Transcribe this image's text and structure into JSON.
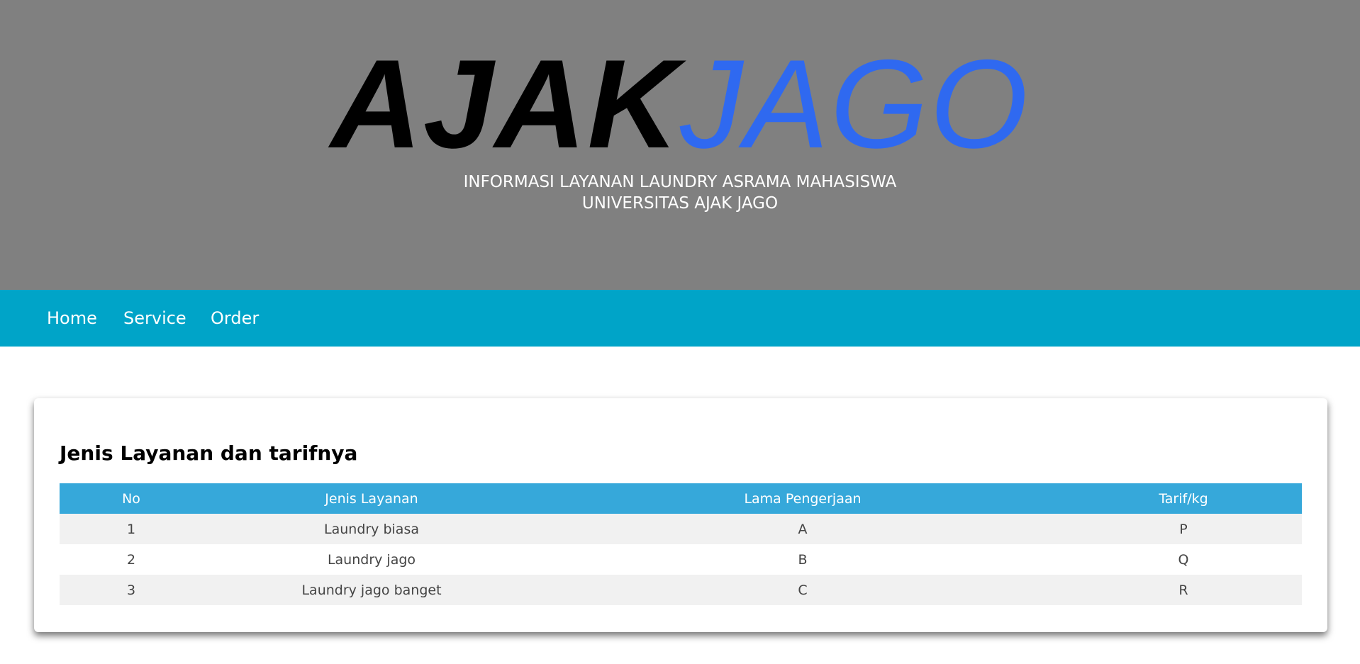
{
  "header": {
    "logo_bold": "AJAK",
    "logo_light": "JAGO",
    "subtitle_line1": "INFORMASI LAYANAN LAUNDRY ASRAMA MAHASISWA",
    "subtitle_line2": "UNIVERSITAS AJAK JAGO"
  },
  "nav": {
    "items": [
      {
        "label": "Home"
      },
      {
        "label": "Service"
      },
      {
        "label": "Order"
      }
    ]
  },
  "services": {
    "title": "Jenis Layanan dan tarifnya",
    "columns": [
      "No",
      "Jenis Layanan",
      "Lama Pengerjaan",
      "Tarif/kg"
    ],
    "rows": [
      [
        "1",
        "Laundry biasa",
        "A",
        "P"
      ],
      [
        "2",
        "Laundry jago",
        "B",
        "Q"
      ],
      [
        "3",
        "Laundry jago banget",
        "C",
        "R"
      ]
    ]
  },
  "colors": {
    "header_bg": "#808080",
    "logo_accent": "#2f69f0",
    "navbar_bg": "#00a4c8",
    "table_header_bg": "#36a8da",
    "row_stripe": "#f1f1f1"
  },
  "icons": []
}
